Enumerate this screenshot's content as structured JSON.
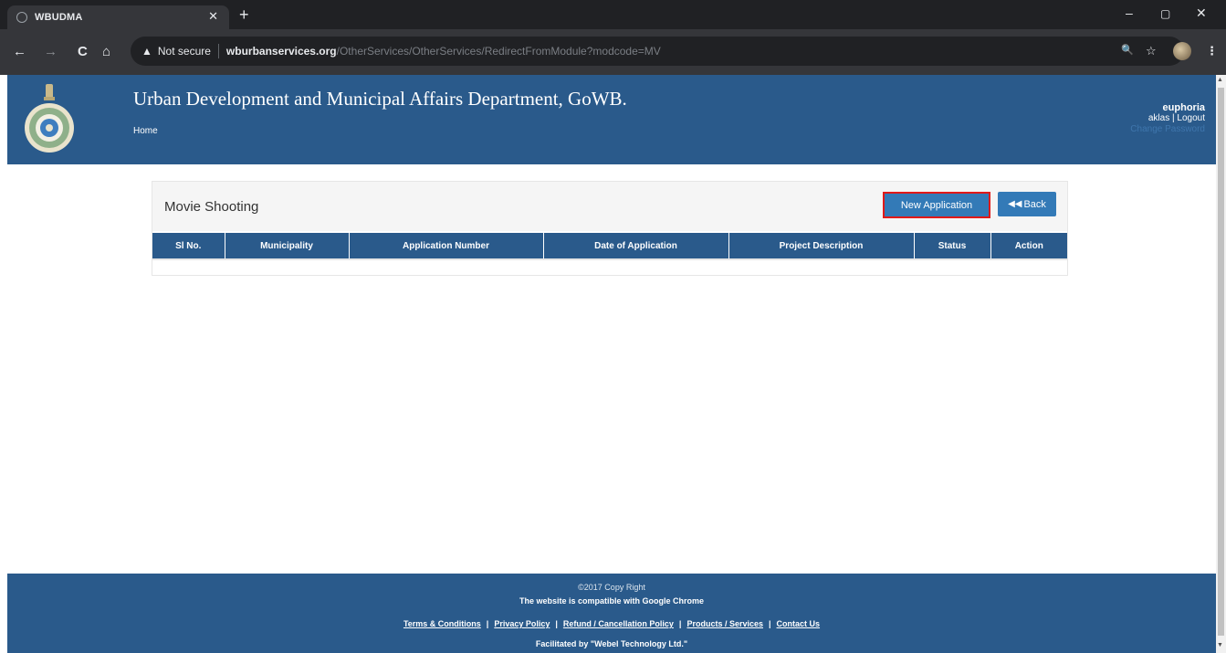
{
  "browser": {
    "tab_title": "WBUDMA",
    "tab_close": "✕",
    "new_tab": "+",
    "security_label": "Not secure",
    "url_host": "wburbanservices.org",
    "url_path": "/OtherServices/OtherServices/RedirectFromModule?modcode=MV",
    "win_min": "–",
    "win_max": "▢",
    "win_close": "✕",
    "back": "←",
    "forward": "→",
    "reload": "C",
    "home": "⌂",
    "zoom": "🔍",
    "star": "☆",
    "menu": "⋮"
  },
  "header": {
    "title": "Urban Development and Municipal Affairs Department, GoWB.",
    "home_link": "Home",
    "user_name": "euphoria",
    "user_id": "aklas",
    "logout": "Logout",
    "change_password": "Change Password"
  },
  "panel": {
    "title": "Movie Shooting",
    "new_application": "New Application",
    "back_icon": "◀◀",
    "back": "Back",
    "columns": [
      "Sl No.",
      "Municipality",
      "Application Number",
      "Date of Application",
      "Project Description",
      "Status",
      "Action"
    ]
  },
  "footer": {
    "copyright": "©2017 Copy Right",
    "compat": "The website is compatible with Google Chrome",
    "links": [
      "Terms & Conditions",
      "Privacy Policy",
      "Refund / Cancellation Policy",
      "Products / Services",
      "Contact Us"
    ],
    "facilitated": "Facilitated by \"Webel Technology Ltd.\""
  },
  "colors": {
    "header_blue": "#2a5a8b",
    "button_blue": "#337ab7",
    "highlight_red": "#e01919"
  }
}
